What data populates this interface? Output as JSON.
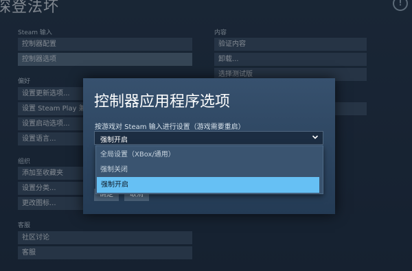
{
  "window": {
    "title": "深登法坏"
  },
  "left_column": {
    "sections": [
      {
        "label": "Steam 输入",
        "items": [
          "控制器配置",
          "控制器选项"
        ]
      },
      {
        "label": "偏好",
        "items": [
          "设置更新选项...",
          "设置 Steam Play 兼",
          "设置启动选项...",
          "设置语言..."
        ]
      },
      {
        "label": "组织",
        "items": [
          "添加至收藏夹",
          "设置分类...",
          "更改图标..."
        ]
      },
      {
        "label": "客服",
        "items": [
          "社区讨论",
          "客服"
        ]
      }
    ]
  },
  "right_column": {
    "section_label": "内容",
    "items": [
      "验证内容",
      "卸载...",
      "选择测试版"
    ]
  },
  "dialog": {
    "title": "控制器应用程序选项",
    "description": "按游戏对 Steam 输入进行设置（游戏需要重启）",
    "select_value": "强制开启",
    "options": [
      "全局设置（XBox/通用）",
      "强制关闭",
      "强制开启"
    ],
    "selected_option": "强制开启",
    "ok_label": "确定",
    "cancel_label": "取消"
  },
  "colors": {
    "accent": "#66c0f4",
    "background": "#1b2838",
    "menu_item": "#3d4f64"
  }
}
